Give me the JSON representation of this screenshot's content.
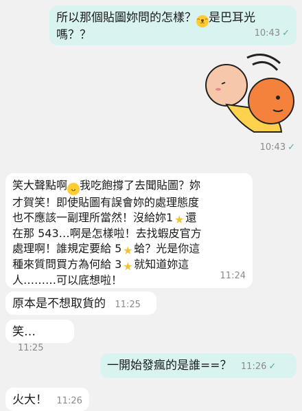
{
  "messages": [
    {
      "id": "m1",
      "direction": "out",
      "line1": "所以那個貼圖妳問的怎樣？",
      "line1_tail": "是巴耳光",
      "line2": "嗎？？",
      "time": "10:43",
      "emoji": "grinning-sweat-face"
    },
    {
      "id": "m2",
      "direction": "out",
      "type": "sticker",
      "sticker_desc": "cartoon-head-slap-sticker",
      "time": "10:43"
    },
    {
      "id": "m3",
      "direction": "in",
      "lines": [
        "笑大聲點啊",
        "我吃飽撐了去聞貼圖？妳",
        "才賀笑！即使貼圖有誤會妳的處理態度",
        "也不應該一副理所當然！沒給妳1",
        "還",
        "在那 543…啊是怎樣啦！去找蝦皮官方",
        "處理啊！誰規定要給 5",
        "蛤？光是你這",
        "種來質問買方為何給 3",
        "就知道妳這",
        "人………可以底想啦！"
      ],
      "time": "11:24"
    },
    {
      "id": "m4",
      "direction": "in",
      "text": "原本是不想取貨的",
      "time": "11:25"
    },
    {
      "id": "m5",
      "direction": "in",
      "text": "笑…",
      "time": "11:25"
    },
    {
      "id": "m6",
      "direction": "out",
      "text": "一開始發瘋的是誰==？",
      "time": "11:26"
    },
    {
      "id": "m7",
      "direction": "in",
      "text": "火大！",
      "time": "11:26"
    }
  ],
  "icons": {
    "read_tick": "checkmark-icon",
    "star": "star-icon",
    "tongue_face": "zany-face-icon",
    "sweat_face": "grinning-sweat-face-icon"
  },
  "colors": {
    "background": "#f1f1f1",
    "outgoing_bubble": "#d9f3f0",
    "incoming_bubble": "#ffffff",
    "tick": "#5aa7a0",
    "star": "#f2c230"
  }
}
